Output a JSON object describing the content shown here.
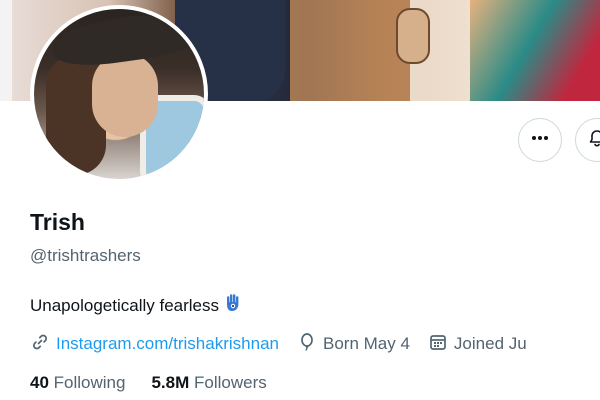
{
  "profile": {
    "name": "Trish",
    "handle": "@trishtrashers",
    "bio": "Unapologetically fearless",
    "bio_emoji": "hamsa-icon",
    "link": "Instagram.com/trishakrishnan",
    "birthday": "Born May 4",
    "joined": "Joined Ju"
  },
  "stats": {
    "following_count": "40",
    "following_label": "Following",
    "followers_count": "5.8M",
    "followers_label": "Followers"
  },
  "icons": {
    "more": "more-horizontal-icon",
    "notifications": "bell-icon",
    "link": "link-icon",
    "birthday": "balloon-icon",
    "joined": "calendar-icon"
  },
  "colors": {
    "link": "#1d9bf0",
    "secondary_text": "#536471",
    "primary_text": "#0f1419",
    "border": "#cfd9de"
  }
}
